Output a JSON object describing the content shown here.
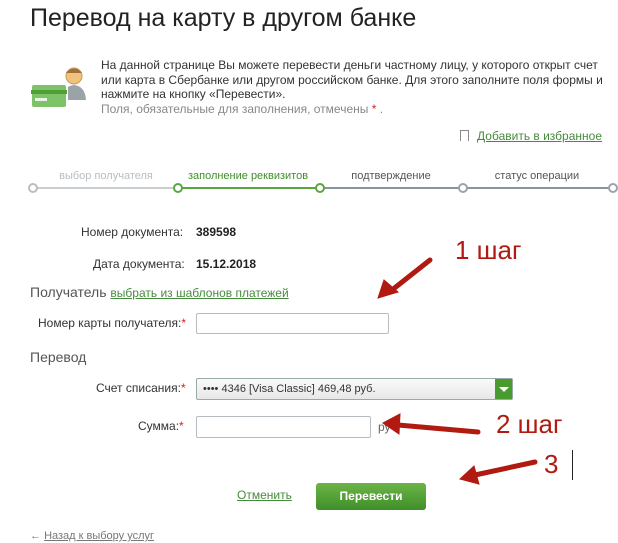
{
  "page": {
    "title": "Перевод на карту в другом банке",
    "intro_text": "На данной странице Вы можете перевести деньги частному лицу, у которого открыт счет или карта в Сбербанке или другом российском банке. Для этого заполните поля формы и нажмите на кнопку «Перевести».",
    "required_note": "Поля, обязательные для заполнения, отмечены",
    "required_star": "*",
    "required_end": ".",
    "favorite_link": "Добавить в избранное"
  },
  "stepper": {
    "steps": [
      {
        "label": "выбор получателя",
        "state": "done"
      },
      {
        "label": "заполнение реквизитов",
        "state": "active"
      },
      {
        "label": "подтверждение",
        "state": "pending"
      },
      {
        "label": "статус операции",
        "state": "pending"
      }
    ]
  },
  "document": {
    "number_label": "Номер документа:",
    "number_value": "389598",
    "date_label": "Дата документа:",
    "date_value": "15.12.2018"
  },
  "recipient": {
    "section_label": "Получатель",
    "templates_link": "выбрать из шаблонов платежей",
    "card_label": "Номер карты получателя:",
    "card_value": ""
  },
  "transfer": {
    "section_label": "Перевод",
    "account_label": "Счет списания:",
    "account_value": "•••• 4346  [Visa Classic] 469,48  руб.",
    "amount_label": "Сумма:",
    "amount_value": "",
    "currency": "ру"
  },
  "actions": {
    "cancel_label": "Отменить",
    "submit_label": "Перевести",
    "back_arrow": "←",
    "back_link": "Назад к выбору услуг"
  },
  "annotations": {
    "step1": "1 шаг",
    "step2": "2 шаг",
    "step3": "3"
  },
  "colors": {
    "accent_green": "#468b3d",
    "button_green": "#4f9f35",
    "annotation_red": "#b01a10",
    "required_red": "#d81e1e"
  }
}
